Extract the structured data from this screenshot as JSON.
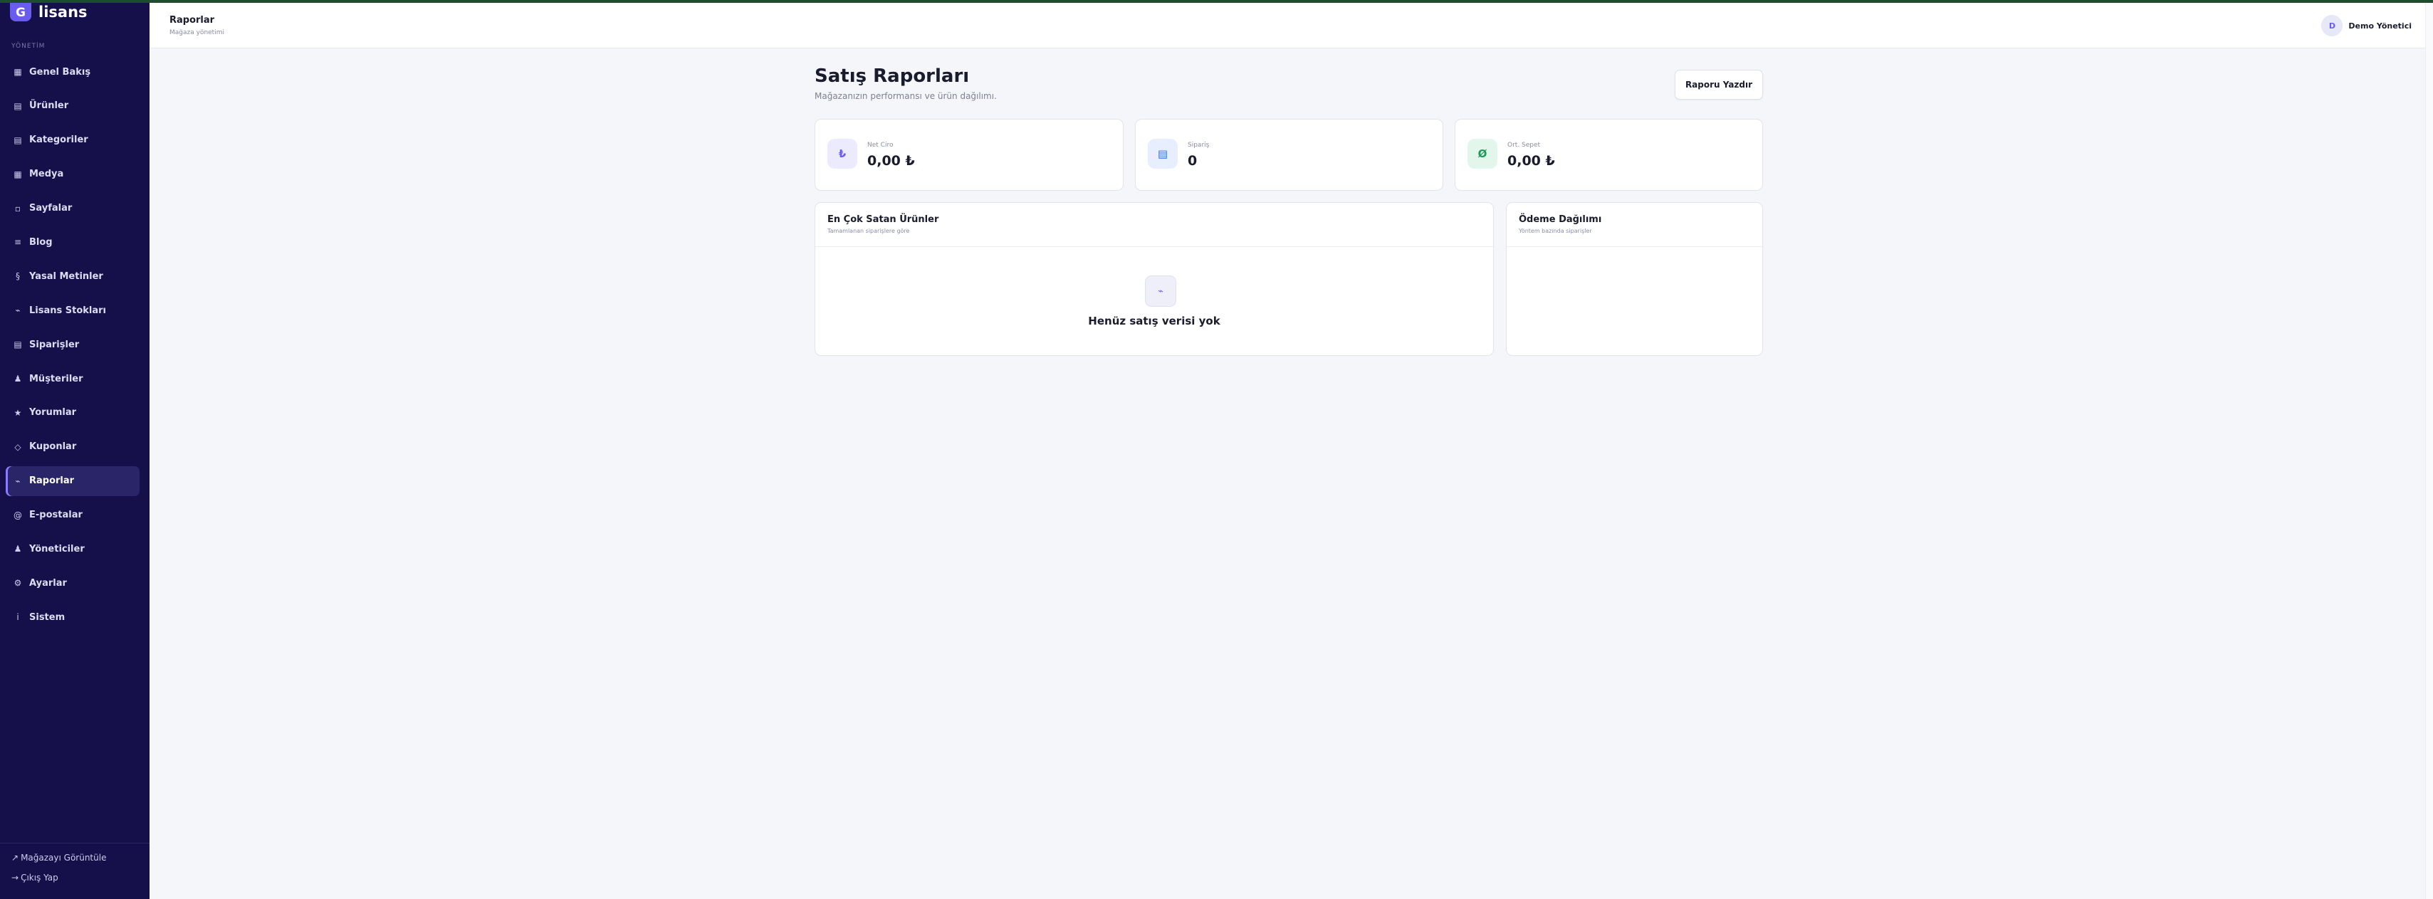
{
  "brand": {
    "logo_letter": "G",
    "name": "lisans"
  },
  "sidebar": {
    "section_label": "YÖNETİM",
    "items": [
      {
        "icon": "grid-icon",
        "glyph": "▦",
        "label": "Genel Bakış"
      },
      {
        "icon": "box-icon",
        "glyph": "▤",
        "label": "Ürünler"
      },
      {
        "icon": "folder-icon",
        "glyph": "▤",
        "label": "Kategoriler"
      },
      {
        "icon": "image-icon",
        "glyph": "▦",
        "label": "Medya"
      },
      {
        "icon": "page-icon",
        "glyph": "▫",
        "label": "Sayfalar"
      },
      {
        "icon": "blog-icon",
        "glyph": "≡",
        "label": "Blog"
      },
      {
        "icon": "section-icon",
        "glyph": "§",
        "label": "Yasal Metinler"
      },
      {
        "icon": "key-icon",
        "glyph": "⌁",
        "label": "Lisans Stokları"
      },
      {
        "icon": "orders-icon",
        "glyph": "▤",
        "label": "Siparişler"
      },
      {
        "icon": "user-icon",
        "glyph": "♟",
        "label": "Müşteriler"
      },
      {
        "icon": "star-icon",
        "glyph": "★",
        "label": "Yorumlar"
      },
      {
        "icon": "coupon-icon",
        "glyph": "◇",
        "label": "Kuponlar"
      },
      {
        "icon": "chart-icon",
        "glyph": "⌁",
        "label": "Raporlar",
        "active": true
      },
      {
        "icon": "at-icon",
        "glyph": "@",
        "label": "E-postalar"
      },
      {
        "icon": "admin-icon",
        "glyph": "♟",
        "label": "Yöneticiler"
      },
      {
        "icon": "gear-icon",
        "glyph": "⚙",
        "label": "Ayarlar"
      },
      {
        "icon": "info-icon",
        "glyph": "i",
        "label": "Sistem"
      }
    ],
    "footer": {
      "view_store_icon": "↗",
      "view_store": "Mağazayı Görüntüle",
      "logout_icon": "→",
      "logout": "Çıkış Yap"
    }
  },
  "header": {
    "title": "Raporlar",
    "subtitle": "Mağaza yönetimi",
    "user_initial": "D",
    "user_name": "Demo Yönetici"
  },
  "main": {
    "title": "Satış Raporları",
    "subtitle": "Mağazanızın performansı ve ürün dağılımı.",
    "print_button": "Raporu Yazdır",
    "stats": [
      {
        "icon": "lira-icon",
        "glyph": "₺",
        "label": "Net Ciro",
        "value": "0,00 ₺",
        "icon_bg": "#eceafd",
        "icon_color": "#6b5cf0"
      },
      {
        "icon": "order-list-icon",
        "glyph": "▤",
        "label": "Sipariş",
        "value": "0",
        "icon_bg": "#e7eefd",
        "icon_color": "#3b6fe0"
      },
      {
        "icon": "basket-avg-icon",
        "glyph": "Ø",
        "label": "Ort. Sepet",
        "value": "0,00 ₺",
        "icon_bg": "#e3f6ec",
        "icon_color": "#1f9a57"
      }
    ],
    "top_products": {
      "title": "En Çok Satan Ürünler",
      "subtitle": "Tamamlanan siparişlere göre",
      "empty_icon_glyph": "⌁",
      "empty_text": "Henüz satış verisi yok"
    },
    "payment_distribution": {
      "title": "Ödeme Dağılımı",
      "subtitle": "Yöntem bazında siparişler"
    }
  }
}
